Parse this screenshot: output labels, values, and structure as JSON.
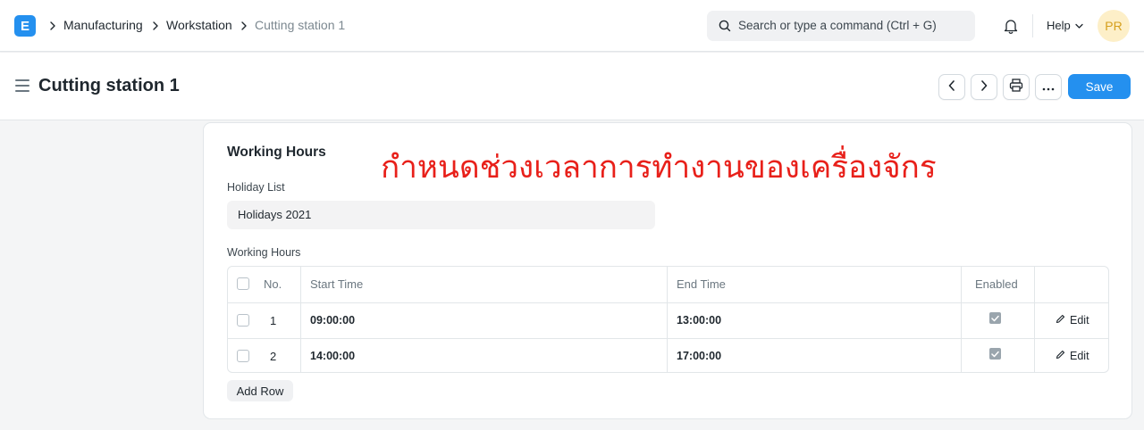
{
  "navbar": {
    "logo_letter": "E",
    "breadcrumbs": [
      "Manufacturing",
      "Workstation",
      "Cutting station 1"
    ],
    "search_placeholder": "Search or type a command (Ctrl + G)",
    "help_label": "Help",
    "avatar_initials": "PR"
  },
  "page": {
    "title": "Cutting station 1",
    "save_label": "Save"
  },
  "section": {
    "title": "Working Hours",
    "annotation": "กำหนดช่วงเวลาการทำงานของเครื่องจักร"
  },
  "holiday": {
    "label": "Holiday List",
    "value": "Holidays 2021"
  },
  "grid": {
    "label": "Working Hours",
    "columns": [
      "No.",
      "Start Time",
      "End Time",
      "Enabled"
    ],
    "rows": [
      {
        "no": "1",
        "start": "09:00:00",
        "end": "13:00:00",
        "enabled": true,
        "edit": "Edit"
      },
      {
        "no": "2",
        "start": "14:00:00",
        "end": "17:00:00",
        "enabled": true,
        "edit": "Edit"
      }
    ],
    "add_row_label": "Add Row"
  },
  "colors": {
    "primary": "#2490ef",
    "annotation": "#e8201a",
    "avatar_bg": "#fdefc8",
    "avatar_fg": "#d59f1c"
  }
}
